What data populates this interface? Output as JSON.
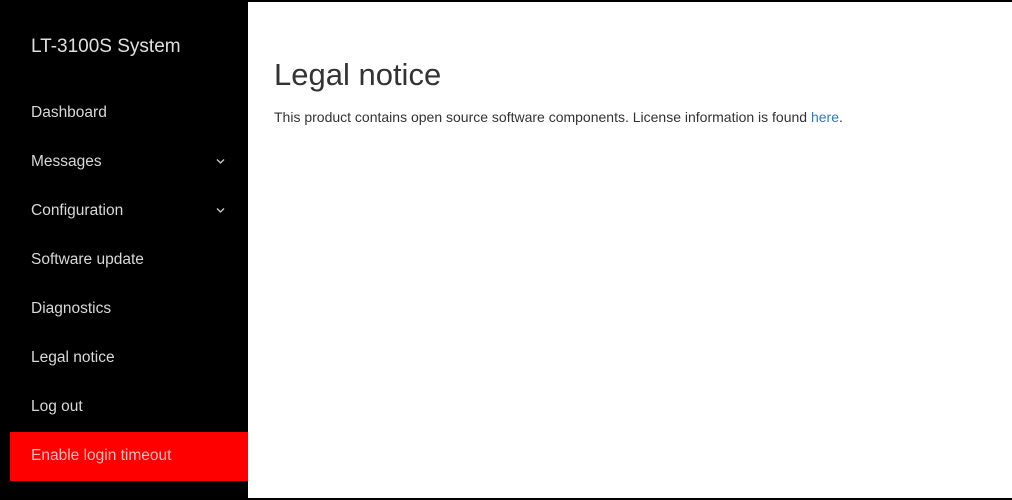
{
  "sidebar": {
    "brand": "LT-3100S System",
    "items": [
      {
        "label": "Dashboard",
        "has_chevron": false
      },
      {
        "label": "Messages",
        "has_chevron": true,
        "icon": "chevron-down-icon"
      },
      {
        "label": "Configuration",
        "has_chevron": true,
        "icon": "chevron-down-icon"
      },
      {
        "label": "Software update",
        "has_chevron": false
      },
      {
        "label": "Diagnostics",
        "has_chevron": false
      },
      {
        "label": "Legal notice",
        "has_chevron": false
      },
      {
        "label": "Log out",
        "has_chevron": false
      },
      {
        "label": "Enable login timeout",
        "has_chevron": false,
        "highlight_color": "#ff0000"
      }
    ]
  },
  "main": {
    "title": "Legal notice",
    "notice_text": "This product contains open source software components. License information is found ",
    "link_text": "here",
    "notice_end": "."
  },
  "colors": {
    "sidebar_bg": "#000000",
    "accent_danger": "#ff0000",
    "link": "#337ab7"
  }
}
